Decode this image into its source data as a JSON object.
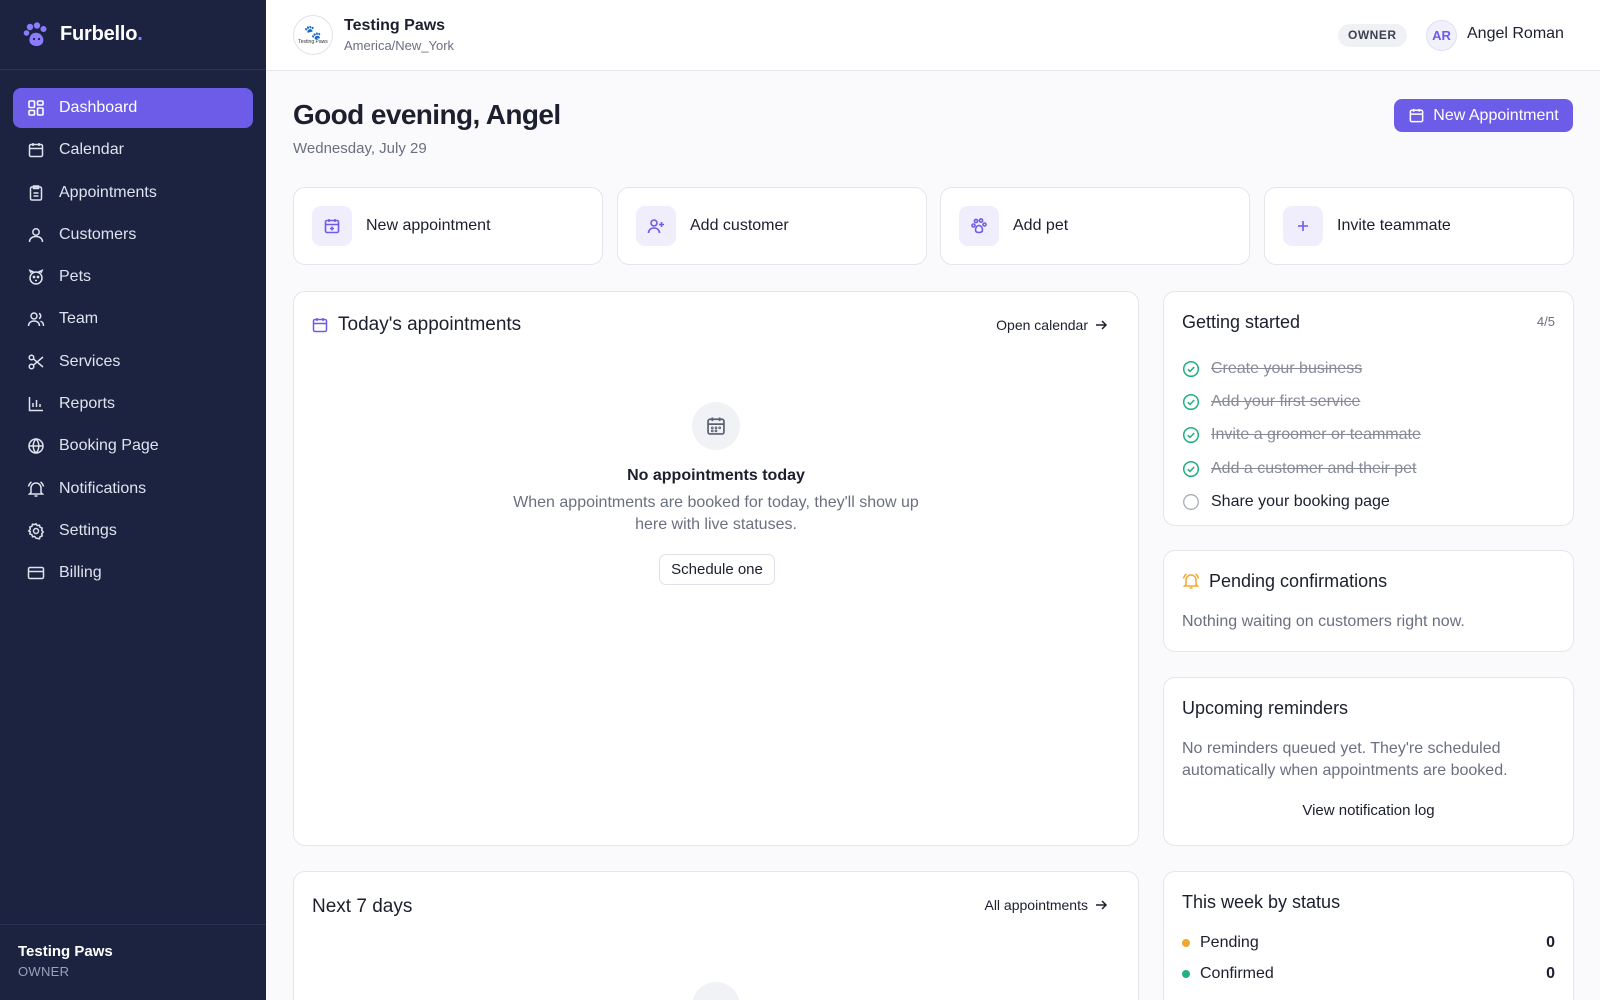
{
  "brand": {
    "name": "Furbello",
    "dot": ".",
    "accent": "#6c5ce7"
  },
  "sidebar": {
    "items": [
      {
        "label": "Dashboard",
        "icon": "dashboard-icon",
        "active": true
      },
      {
        "label": "Calendar",
        "icon": "calendar-icon"
      },
      {
        "label": "Appointments",
        "icon": "clipboard-icon"
      },
      {
        "label": "Customers",
        "icon": "user-icon"
      },
      {
        "label": "Pets",
        "icon": "paw-icon"
      },
      {
        "label": "Team",
        "icon": "users-icon"
      },
      {
        "label": "Services",
        "icon": "scissors-icon"
      },
      {
        "label": "Reports",
        "icon": "bar-chart-icon"
      },
      {
        "label": "Booking Page",
        "icon": "globe-icon"
      },
      {
        "label": "Notifications",
        "icon": "bell-icon"
      },
      {
        "label": "Settings",
        "icon": "gear-icon"
      },
      {
        "label": "Billing",
        "icon": "credit-card-icon"
      }
    ],
    "footer": {
      "business": "Testing Paws",
      "role": "OWNER"
    }
  },
  "topbar": {
    "business_name": "Testing Paws",
    "timezone": "America/New_York",
    "logo_text": "Testing Paws",
    "role_badge": "OWNER",
    "avatar_initials": "AR",
    "user_name": "Angel Roman"
  },
  "header": {
    "greeting": "Good evening, Angel",
    "date": "Wednesday, July 29",
    "new_appointment_label": "New Appointment"
  },
  "quick_actions": [
    {
      "label": "New appointment",
      "icon": "calendar-plus-icon"
    },
    {
      "label": "Add customer",
      "icon": "user-plus-icon"
    },
    {
      "label": "Add pet",
      "icon": "paw-icon"
    },
    {
      "label": "Invite teammate",
      "icon": "plus-icon"
    }
  ],
  "today": {
    "title": "Today's appointments",
    "link": "Open calendar",
    "empty_title": "No appointments today",
    "empty_desc": "When appointments are booked for today, they'll show up here with live statuses.",
    "button": "Schedule one"
  },
  "next7": {
    "title": "Next 7 days",
    "link": "All appointments"
  },
  "getting_started": {
    "title": "Getting started",
    "progress": "4/5",
    "items": [
      {
        "label": "Create your business",
        "done": true
      },
      {
        "label": "Add your first service",
        "done": true
      },
      {
        "label": "Invite a groomer or teammate",
        "done": true
      },
      {
        "label": "Add a customer and their pet",
        "done": true
      },
      {
        "label": "Share your booking page",
        "done": false
      }
    ]
  },
  "pending": {
    "title": "Pending confirmations",
    "text": "Nothing waiting on customers right now."
  },
  "reminders": {
    "title": "Upcoming reminders",
    "text": "No reminders queued yet. They're scheduled automatically when appointments are booked.",
    "link": "View notification log"
  },
  "week_status": {
    "title": "This week by status",
    "rows": [
      {
        "label": "Pending",
        "count": "0",
        "color": "#f0a830"
      },
      {
        "label": "Confirmed",
        "count": "0",
        "color": "#22b07d"
      }
    ]
  }
}
